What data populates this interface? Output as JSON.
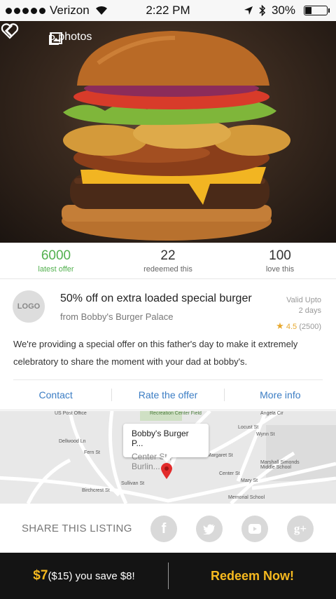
{
  "status_bar": {
    "carrier": "Verizon",
    "time": "2:22 PM",
    "battery": "30%",
    "battery_level": 0.3
  },
  "hero": {
    "photos_label": "5 photos",
    "back_icon": "chevron-left-icon",
    "gallery_icon": "image-icon",
    "favorite_icon": "heart-outline-icon"
  },
  "stats": [
    {
      "value": "6000",
      "label": "latest offer",
      "color": "#52b04e"
    },
    {
      "value": "22",
      "label": "redeemed this"
    },
    {
      "value": "100",
      "label": "love this"
    }
  ],
  "offer": {
    "logo_text": "LOGO",
    "title": "50% off on extra loaded special burger",
    "from": "from Bobby's Burger Palace",
    "valid_label": "Valid Upto",
    "valid_value": "2 days",
    "rating": "4.5",
    "rating_count": "(2500)",
    "description": "We're providing a special offer on this father's day to make it extremely celebratory to share the moment with your dad at bobby's.",
    "links": [
      "Contact",
      "Rate the offer",
      "More info"
    ],
    "link_color": "#3b7dc4"
  },
  "map": {
    "place_name": "Bobby's Burger P...",
    "place_address": "Center St., Burlin...",
    "labels": {
      "post_office": "US Post Office",
      "recreation": "Recreation Center Field",
      "middle_school": "Marshall Simonds Middle School",
      "memorial_school": "Memorial School",
      "center_st": "Center St",
      "birchcrest": "Birchcrest St",
      "dellwood": "Dellwood Ln",
      "sullivan": "Sullivan St",
      "wynn": "Wynn St",
      "margaret": "Margaret St",
      "angela": "Angela Cir",
      "locust": "Locust St",
      "mary": "Mary St",
      "fern": "Fern St"
    }
  },
  "share": {
    "title": "SHARE THIS LISTING",
    "icons": [
      "facebook-icon",
      "twitter-icon",
      "youtube-icon",
      "google-plus-icon"
    ]
  },
  "footer": {
    "price": "$7",
    "original": "($15) you save $8!",
    "cta": "Redeem Now!",
    "accent": "#f6b91f"
  }
}
